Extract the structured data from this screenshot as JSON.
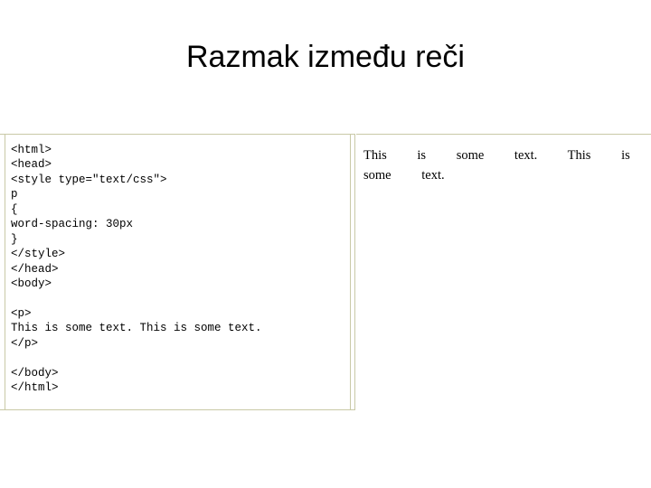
{
  "slide": {
    "title": "Razmak između reči",
    "code_panel": {
      "code": "<html>\n<head>\n<style type=\"text/css\">\np\n{\nword-spacing: 30px\n}\n</style>\n</head>\n<body>\n\n<p>\nThis is some text. This is some text.\n</p>\n\n</body>\n</html>"
    },
    "render_panel": {
      "rendered_text": "This is some text. This is some text."
    }
  },
  "colors": {
    "panel_border": "#c9c9a6",
    "text": "#000000",
    "background": "#ffffff"
  }
}
